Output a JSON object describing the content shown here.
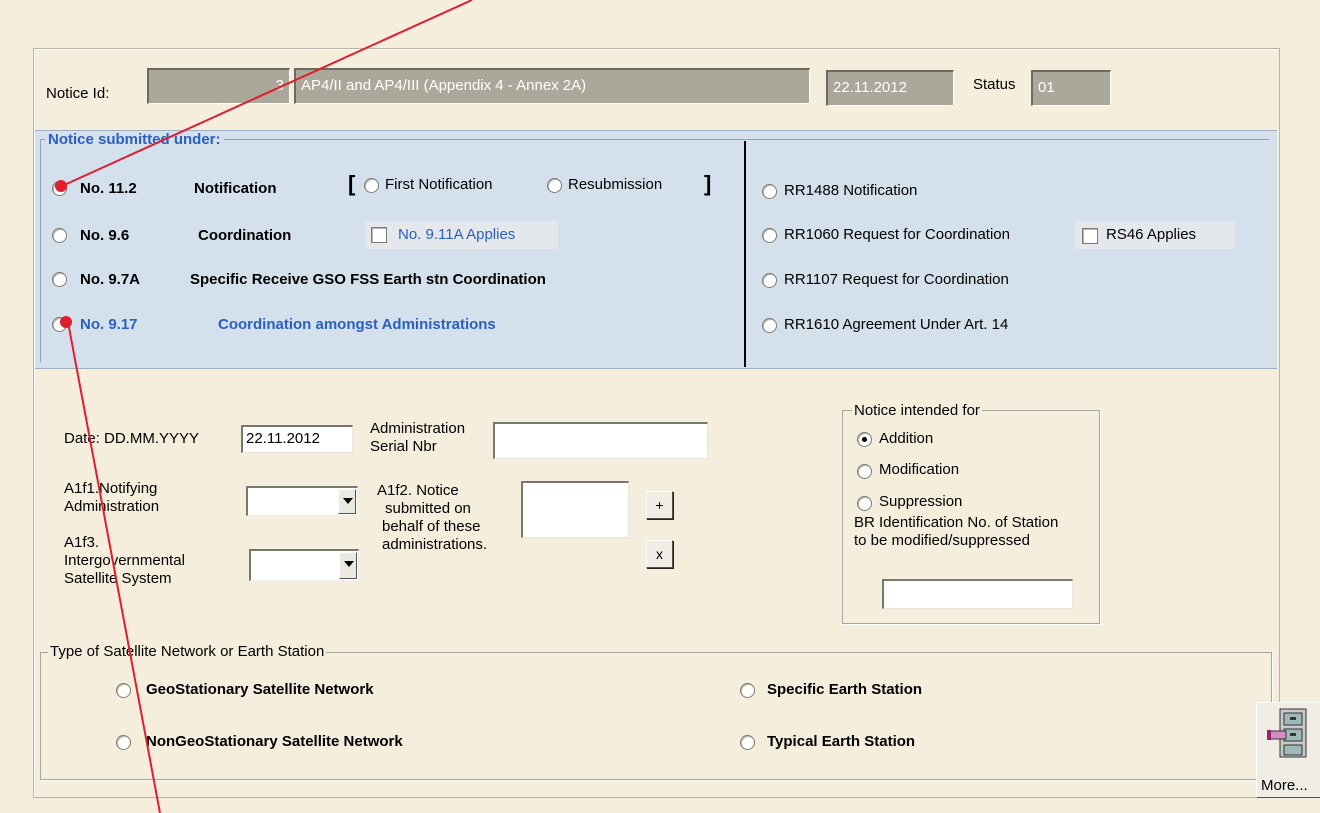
{
  "header": {
    "notice_id_label": "Notice Id:",
    "notice_id_value": "3",
    "notice_title": "AP4/II and AP4/III (Appendix 4 - Annex 2A)",
    "date_value": "22.11.2012",
    "status_label": "Status",
    "status_value": "01"
  },
  "submitted": {
    "title": "Notice submitted under:",
    "left": [
      {
        "num": "No. 11.2",
        "name": "Notification",
        "selected": false
      },
      {
        "num": "No. 9.6",
        "name": "Coordination",
        "selected": false
      },
      {
        "num": "No. 9.7A",
        "name": "Specific Receive GSO FSS Earth stn Coordination",
        "selected": false
      },
      {
        "num": "No. 9.17",
        "name": "Coordination amongst Administrations",
        "selected": false
      }
    ],
    "bracket_open": "[",
    "bracket_close": "]",
    "first_notification": "First Notification",
    "resubmission": "Resubmission",
    "applies_911a": "No. 9.11A Applies",
    "right": [
      "RR1488 Notification",
      "RR1060 Request for Coordination",
      "RR1107 Request for Coordination",
      "RR1610 Agreement Under Art. 14"
    ],
    "rs46": "RS46 Applies"
  },
  "form": {
    "date_label": "Date: DD.MM.YYYY",
    "date_value": "22.11.2012",
    "admin_serial_label_1": "Administration",
    "admin_serial_label_2": "Serial Nbr",
    "admin_serial_value": "",
    "a1f1_label_1": "A1f1.Notifying",
    "a1f1_label_2": "Administration",
    "a1f3_label_1": "A1f3.",
    "a1f3_label_2": "Intergovernmental",
    "a1f3_label_3": "Satellite System",
    "a1f2_label_1": "A1f2. Notice",
    "a1f2_label_2": "submitted on",
    "a1f2_label_3": "behalf of these",
    "a1f2_label_4": "administrations.",
    "plus": "+",
    "x": "x"
  },
  "intended": {
    "title": "Notice intended for",
    "options": [
      "Addition",
      "Modification",
      "Suppression"
    ],
    "selected": "Addition",
    "br_label_1": "BR Identification No. of Station",
    "br_label_2": "to be modified/suppressed",
    "br_value": ""
  },
  "type_group": {
    "title": "Type of Satellite Network or Earth Station",
    "geo": "GeoStationary Satellite Network",
    "nongeo": "NonGeoStationary Satellite Network",
    "specific": "Specific Earth Station",
    "typical": "Typical Earth Station"
  },
  "more_button": {
    "label": "More..."
  },
  "colors": {
    "background": "#f5eedc",
    "blue_panel": "#d4e1ec",
    "accent_text": "#2b5fc4",
    "annotation": "#e01e2e"
  }
}
